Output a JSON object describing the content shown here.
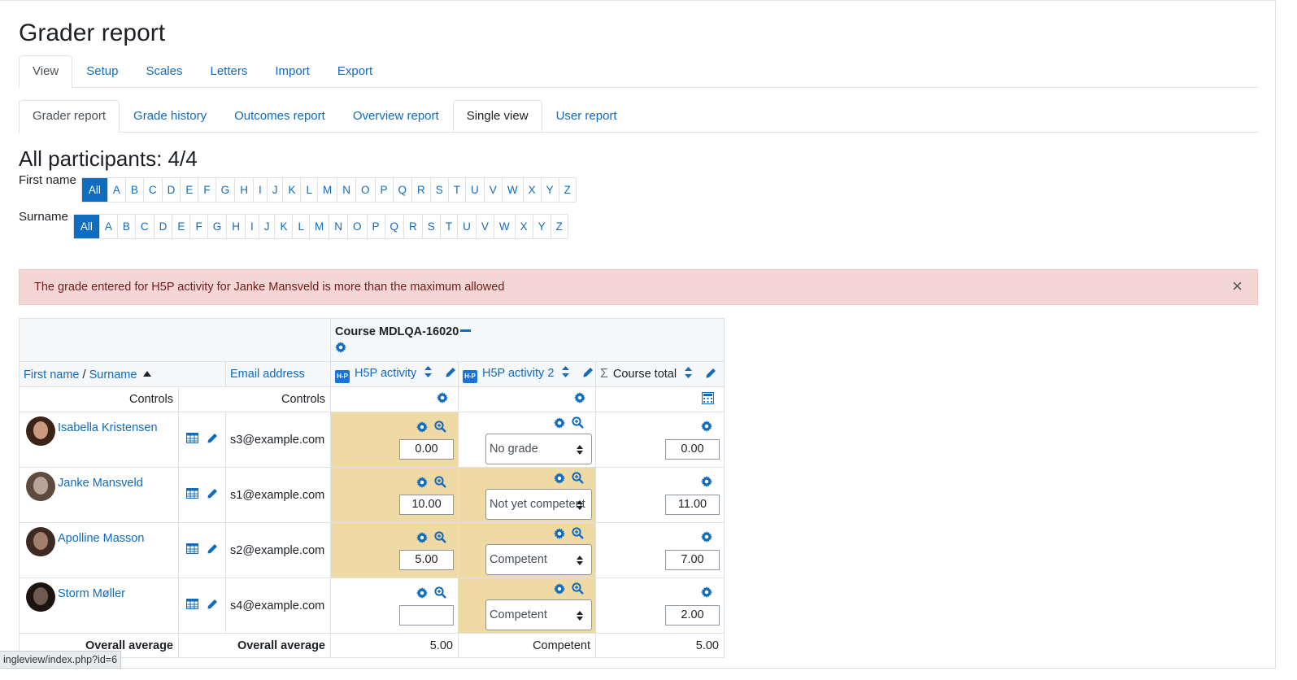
{
  "page": {
    "title": "Grader report"
  },
  "tabs_primary": [
    "View",
    "Setup",
    "Scales",
    "Letters",
    "Import",
    "Export"
  ],
  "tabs_secondary": [
    "Grader report",
    "Grade history",
    "Outcomes report",
    "Overview report",
    "Single view",
    "User report"
  ],
  "participants": "All participants: 4/4",
  "first_name_filter": {
    "label": "First name",
    "letters": [
      "All",
      "A",
      "B",
      "C",
      "D",
      "E",
      "F",
      "G",
      "H",
      "I",
      "J",
      "K",
      "L",
      "M",
      "N",
      "O",
      "P",
      "Q",
      "R",
      "S",
      "T",
      "U",
      "V",
      "W",
      "X",
      "Y",
      "Z"
    ]
  },
  "surname_filter": {
    "label": "Surname",
    "letters": [
      "All",
      "A",
      "B",
      "C",
      "D",
      "E",
      "F",
      "G",
      "H",
      "I",
      "J",
      "K",
      "L",
      "M",
      "N",
      "O",
      "P",
      "Q",
      "R",
      "S",
      "T",
      "U",
      "V",
      "W",
      "X",
      "Y",
      "Z"
    ]
  },
  "alert": {
    "message": "The grade entered for H5P activity for Janke Mansveld is more than the maximum allowed",
    "close": "×"
  },
  "table": {
    "course_header": "Course MDLQA-16020",
    "col_firstname": "First name",
    "col_sep": " / ",
    "col_surname": "Surname",
    "col_email": "Email address",
    "col_item1": "H5P activity",
    "col_item2": "H5P activity 2",
    "col_total": "Course total",
    "controls_label": "Controls",
    "h5p_badge": "H-P",
    "sigma": "Σ",
    "rows": [
      {
        "name": "Isabella Kristensen",
        "email": "s3@example.com",
        "grade1": "0.00",
        "grade2": "No grade",
        "total": "0.00"
      },
      {
        "name": "Janke Mansveld",
        "email": "s1@example.com",
        "grade1": "10.00",
        "grade2": "Not yet competent",
        "total": "11.00"
      },
      {
        "name": "Apolline Masson",
        "email": "s2@example.com",
        "grade1": "5.00",
        "grade2": "Competent",
        "total": "7.00"
      },
      {
        "name": "Storm Møller",
        "email": "s4@example.com",
        "grade1": "",
        "grade2": "Competent",
        "total": "2.00"
      }
    ],
    "overall_label": "Overall average",
    "avg_item1": "5.00",
    "avg_item2": "Competent",
    "avg_total": "5.00"
  },
  "statusbar": "ingleview/index.php?id=6",
  "colors": {
    "link": "#0f6cbf",
    "alert_bg": "#f4d6d5",
    "overridden_bg": "#efd9a5"
  }
}
